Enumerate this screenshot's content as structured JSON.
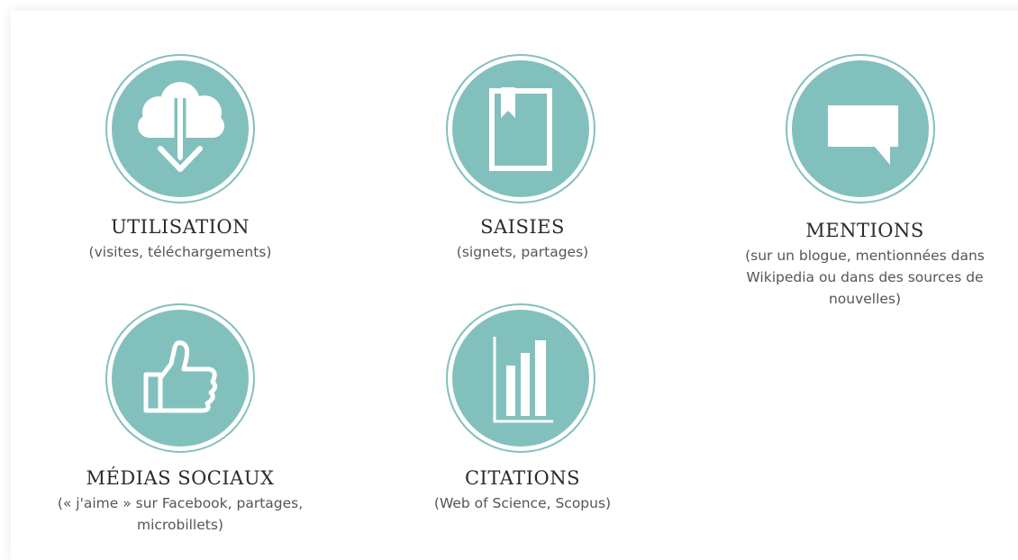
{
  "accent_color": "#82c0bd",
  "metrics": [
    {
      "title": "UTILISATION",
      "subtitle": "(visites, téléchargements)",
      "icon": "cloud-download-icon"
    },
    {
      "title": "SAISIES",
      "subtitle": "(signets, partages)",
      "icon": "bookmark-icon"
    },
    {
      "title": "MENTIONS",
      "subtitle": "(sur un blogue, mentionnées dans Wikipedia ou dans des sources de nouvelles)",
      "icon": "speech-bubble-icon"
    },
    {
      "title": "MÉDIAS SOCIAUX",
      "subtitle": "(« j'aime » sur Facebook, partages, microbillets)",
      "icon": "thumbs-up-icon"
    },
    {
      "title": "CITATIONS",
      "subtitle": "(Web of Science, Scopus)",
      "icon": "bar-chart-icon"
    }
  ]
}
